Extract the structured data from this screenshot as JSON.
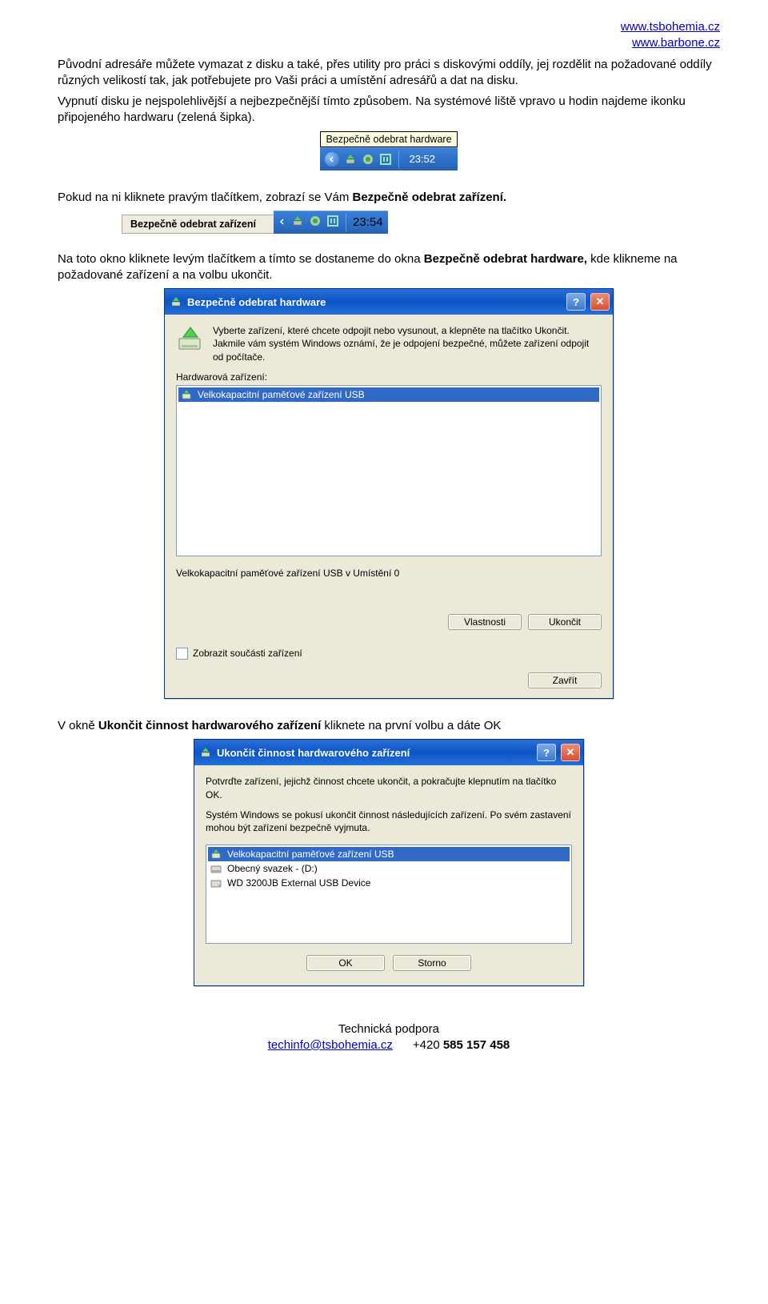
{
  "header": {
    "url1": "www.tsbohemia.cz",
    "url2": "www.barbone.cz"
  },
  "para1": "Původní adresáře můžete vymazat z disku a také, přes utility pro práci s diskovými oddíly, jej rozdělit na požadované oddíly různých velikostí tak, jak potřebujete pro Vaši práci a umístění adresářů a dat na disku.",
  "para2": "Vypnutí disku je nejspolehlivější a nejbezpečnější tímto způsobem. Na systémové liště vpravo u hodin najdeme ikonku připojeného hardwaru (zelená šipka).",
  "tooltip1": "Bezpečně odebrat hardware",
  "tray1_time": "23:52",
  "para3_a": "Pokud na ni kliknete pravým tlačítkem, zobrazí se Vám ",
  "para3_b": "Bezpečně odebrat zařízení.",
  "tooltip2_button": "Bezpečně odebrat zařízení",
  "tray2_time": "23:54",
  "para4_a": "Na toto okno kliknete levým tlačítkem a tímto se dostaneme do okna ",
  "para4_b": "Bezpečně odebrat hardware,",
  "para4_c": " kde klikneme na požadované zařízení a na volbu ukončit.",
  "dialog1": {
    "title": "Bezpečně odebrat hardware",
    "intro": "Vyberte zařízení, které chcete odpojit nebo vysunout, a klepněte na tlačítko Ukončit. Jakmile vám systém Windows oznámí, že je odpojení bezpečné, můžete zařízení odpojit od počítače.",
    "label": "Hardwarová zařízení:",
    "list_item": "Velkokapacitní paměťové zařízení USB",
    "desc": "Velkokapacitní paměťové zařízení USB v Umístění 0",
    "btn_props": "Vlastnosti",
    "btn_stop": "Ukončit",
    "chk_label": "Zobrazit součásti zařízení",
    "btn_close": "Zavřít"
  },
  "para5_a": "V okně ",
  "para5_b": "Ukončit činnost hardwarového zařízení",
  "para5_c": " kliknete na první volbu a dáte OK",
  "dialog2": {
    "title": "Ukončit činnost hardwarového zařízení",
    "intro1": "Potvrďte zařízení, jejichž činnost chcete ukončit, a pokračujte klepnutím na tlačítko OK.",
    "intro2": "Systém Windows se pokusí ukončit činnost následujících zařízení. Po svém zastavení mohou být zařízení bezpečně vyjmuta.",
    "item1": "Velkokapacitní paměťové zařízení USB",
    "item2": "Obecný svazek - (D:)",
    "item3": "WD 3200JB External USB Device",
    "btn_ok": "OK",
    "btn_cancel": "Storno"
  },
  "footer": {
    "title": "Technická podpora",
    "email": "techinfo@tsbohemia.cz",
    "phone_prefix": "+420 ",
    "phone": "585 157 458"
  }
}
